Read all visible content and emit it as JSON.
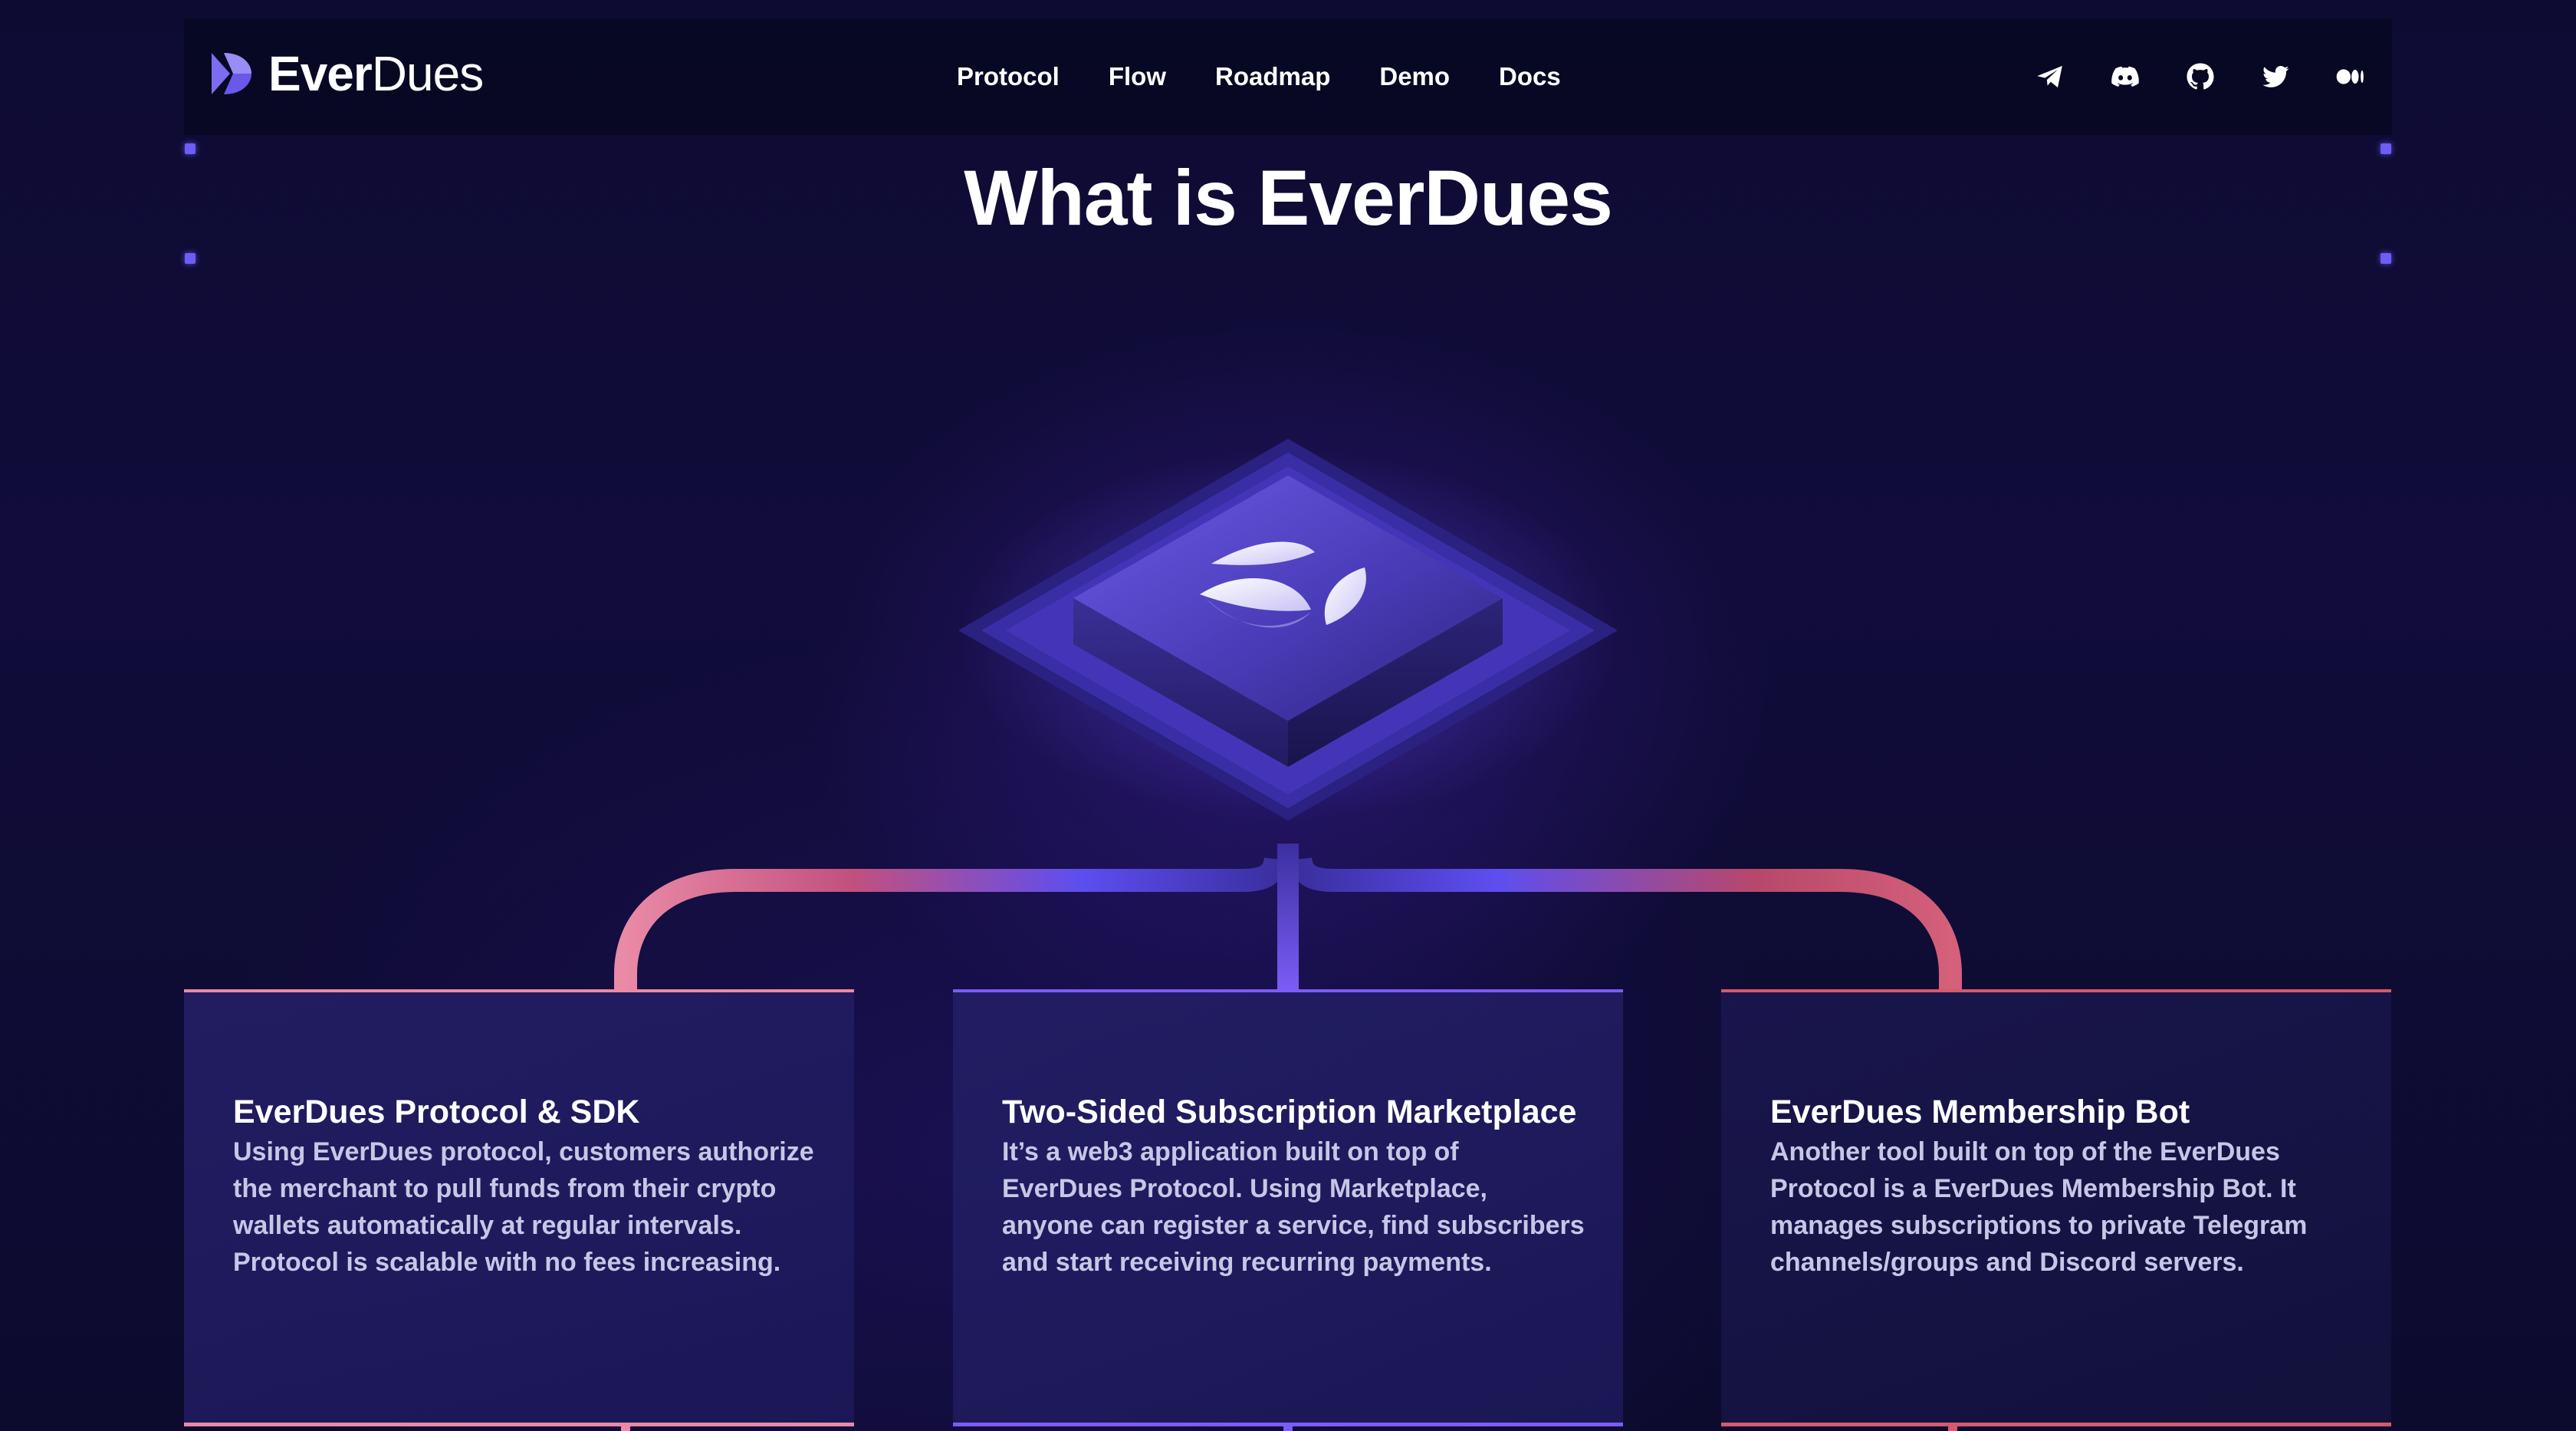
{
  "brand": {
    "name_part1": "Ever",
    "name_part2": "Dues"
  },
  "nav": {
    "items": [
      {
        "label": "Protocol",
        "name": "nav-protocol"
      },
      {
        "label": "Flow",
        "name": "nav-flow"
      },
      {
        "label": "Roadmap",
        "name": "nav-roadmap"
      },
      {
        "label": "Demo",
        "name": "nav-demo"
      },
      {
        "label": "Docs",
        "name": "nav-docs"
      }
    ]
  },
  "socials": [
    "telegram-icon",
    "discord-icon",
    "github-icon",
    "twitter-icon",
    "medium-icon"
  ],
  "section": {
    "title": "What is EverDues"
  },
  "cards": [
    {
      "title": "EverDues Protocol & SDK",
      "text": "Using EverDues protocol, customers authorize the merchant to pull funds from their crypto wallets automatically at regular intervals. Protocol is scalable with no fees increasing."
    },
    {
      "title": "Two-Sided Subscription Marketplace",
      "text": "It’s a web3 application built on top of EverDues Protocol. Using Marketplace, anyone can register a service, find subscribers and start receiving recurring payments."
    },
    {
      "title": "EverDues Membership Bot",
      "text": "Another tool built on top of the EverDues Protocol is a EverDues Membership Bot. It manages subscriptions to private Telegram channels/groups and Discord servers."
    }
  ],
  "colors": {
    "accent": "#6d5cf5",
    "pink": "#e97a9a",
    "violet": "#7b5cf5",
    "red": "#d45a6e"
  }
}
